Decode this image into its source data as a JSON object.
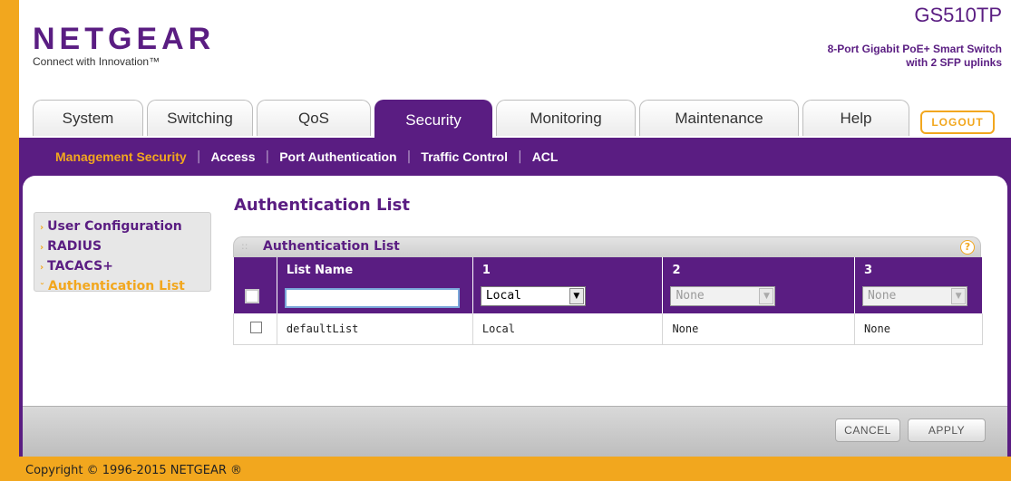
{
  "brand": {
    "logo": "NETGEAR",
    "tagline": "Connect with Innovation™",
    "model": "GS510TP",
    "description_line1": "8-Port Gigabit PoE+ Smart Switch",
    "description_line2": "with 2 SFP uplinks",
    "accent_purple": "#5a1d82",
    "accent_orange": "#f2a71e"
  },
  "tabs": [
    {
      "label": "System"
    },
    {
      "label": "Switching"
    },
    {
      "label": "QoS"
    },
    {
      "label": "Security"
    },
    {
      "label": "Monitoring"
    },
    {
      "label": "Maintenance"
    },
    {
      "label": "Help"
    }
  ],
  "active_tab": "Security",
  "logout_label": "LOGOUT",
  "subnav": [
    {
      "label": "Management Security"
    },
    {
      "label": "Access"
    },
    {
      "label": "Port Authentication"
    },
    {
      "label": "Traffic Control"
    },
    {
      "label": "ACL"
    }
  ],
  "sidebar": {
    "items": [
      {
        "label": "User Configuration",
        "icon": "chevron-right-icon"
      },
      {
        "label": "RADIUS",
        "icon": "chevron-right-icon"
      },
      {
        "label": "TACACS+",
        "icon": "chevron-right-icon"
      },
      {
        "label": "Authentication List",
        "icon": "chevron-down-icon"
      }
    ]
  },
  "page_title": "Authentication List",
  "box_title": "Authentication List",
  "table": {
    "headers": [
      "",
      "List Name",
      "1",
      "2",
      "3"
    ],
    "input_row": {
      "list_name_value": "",
      "method1": "Local",
      "method2": "None",
      "method3": "None"
    },
    "rows": [
      {
        "name": "defaultList",
        "m1": "Local",
        "m2": "None",
        "m3": "None"
      }
    ]
  },
  "buttons": {
    "cancel": "CANCEL",
    "apply": "APPLY"
  },
  "copyright": "Copyright © 1996-2015 NETGEAR ®"
}
